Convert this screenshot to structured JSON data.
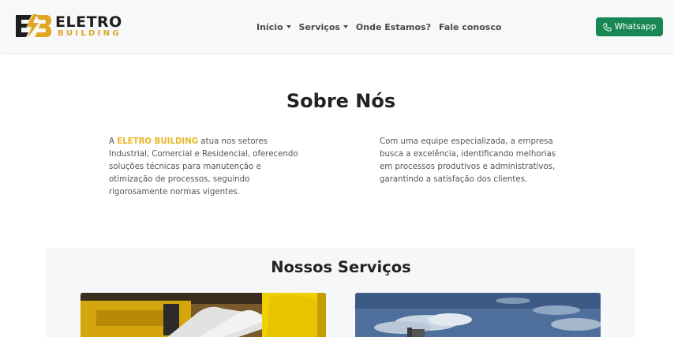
{
  "brand": {
    "word1": "ELETRO",
    "word2": "BUILDING",
    "mark_icon": "eletro-building-logo-mark",
    "accent_color": "#e0a521"
  },
  "nav": {
    "items": [
      {
        "label": "Início",
        "has_dropdown": true
      },
      {
        "label": "Serviços",
        "has_dropdown": true
      },
      {
        "label": "Onde Estamos?",
        "has_dropdown": false
      },
      {
        "label": "Fale conosco",
        "has_dropdown": false
      }
    ]
  },
  "whatsapp": {
    "label": "Whatsapp",
    "icon": "phone-icon",
    "color": "#198754"
  },
  "about": {
    "title": "Sobre Nós",
    "left": {
      "prefix": "A ",
      "highlight": "ELETRO BUILDING",
      "text": " atua nos setores Industrial, Comercial e Residencial, oferecendo soluções técnicas para manutenção e otimização de processos, seguindo rigorosamente normas vigentes."
    },
    "right": {
      "text": "Com uma equipe especializada, a empresa busca a excelência, identificando melhorias em processos produtivos e administrativos, garantindo a satisfação dos clientes."
    },
    "highlight_color": "#e8b626"
  },
  "services": {
    "title": "Nossos Serviços",
    "cards": [
      {
        "image": "industrial-equipment-photo"
      },
      {
        "image": "sky-and-structure-photo"
      }
    ]
  }
}
